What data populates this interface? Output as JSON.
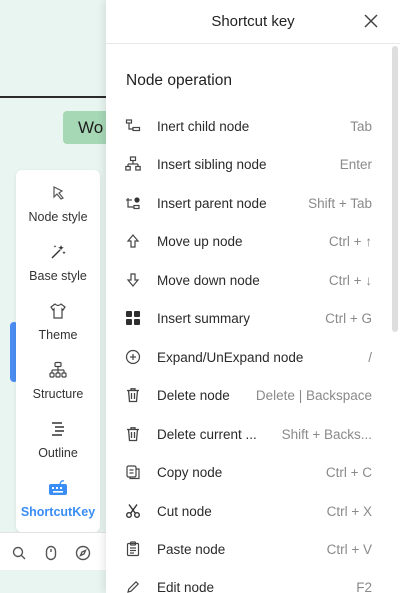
{
  "canvas": {
    "node_text": "Wo"
  },
  "toolbar": {
    "items": [
      {
        "label": "Node style",
        "icon": "node-style-icon"
      },
      {
        "label": "Base style",
        "icon": "magic-wand-icon"
      },
      {
        "label": "Theme",
        "icon": "shirt-icon"
      },
      {
        "label": "Structure",
        "icon": "structure-icon"
      },
      {
        "label": "Outline",
        "icon": "outline-icon"
      },
      {
        "label": "ShortcutKey",
        "icon": "keyboard-icon",
        "active": true
      }
    ],
    "bottom_icons": [
      "search-icon",
      "mouse-icon",
      "compass-icon"
    ]
  },
  "panel": {
    "title": "Shortcut key",
    "section_title": "Node operation",
    "rows": [
      {
        "name": "Inert child node",
        "key": "Tab",
        "icon": "child-node-icon"
      },
      {
        "name": "Insert sibling node",
        "key": "Enter",
        "icon": "sibling-node-icon"
      },
      {
        "name": "Insert parent node",
        "key": "Shift + Tab",
        "icon": "parent-node-icon"
      },
      {
        "name": "Move up node",
        "key": "Ctrl + ↑",
        "icon": "arrow-up-icon"
      },
      {
        "name": "Move down node",
        "key": "Ctrl + ↓",
        "icon": "arrow-down-icon"
      },
      {
        "name": "Insert summary",
        "key": "Ctrl + G",
        "icon": "summary-icon"
      },
      {
        "name": "Expand/UnExpand node",
        "key": "/",
        "icon": "expand-icon"
      },
      {
        "name": "Delete node",
        "key": "Delete | Backspace",
        "icon": "trash-icon"
      },
      {
        "name": "Delete current ...",
        "key": "Shift + Backs...",
        "icon": "trash-icon"
      },
      {
        "name": "Copy node",
        "key": "Ctrl + C",
        "icon": "copy-icon"
      },
      {
        "name": "Cut node",
        "key": "Ctrl + X",
        "icon": "scissors-icon"
      },
      {
        "name": "Paste node",
        "key": "Ctrl + V",
        "icon": "paste-icon"
      },
      {
        "name": "Edit node",
        "key": "F2",
        "icon": "pencil-icon"
      }
    ]
  },
  "colors": {
    "accent": "#3a8df5",
    "canvas_bg": "#e9f5f0",
    "node_chip": "#a7d8b6"
  }
}
